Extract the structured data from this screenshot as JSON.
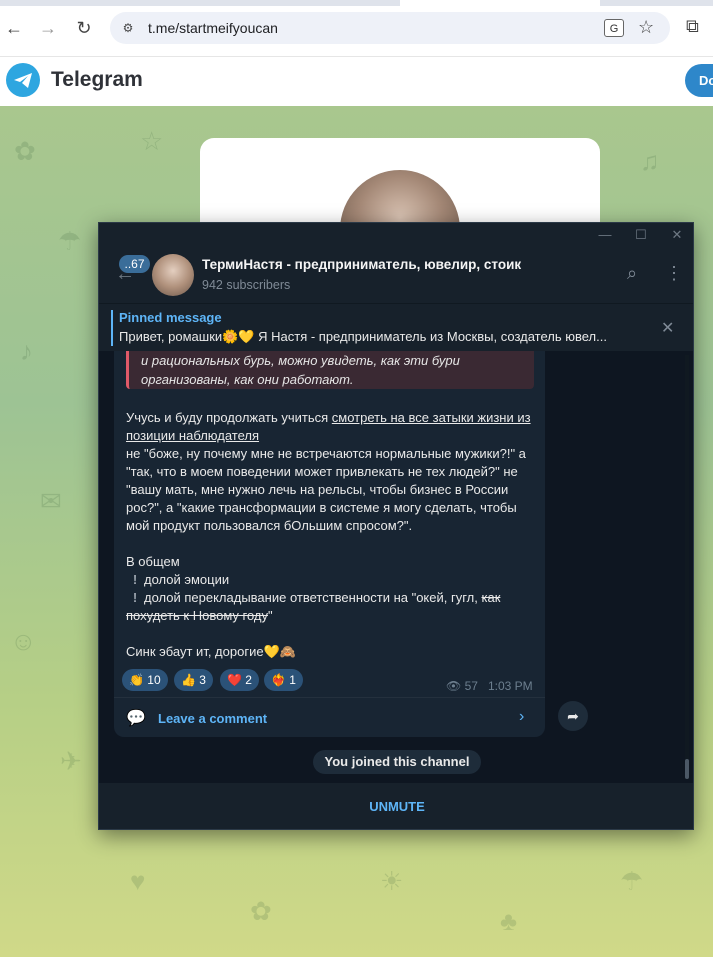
{
  "browser": {
    "url": "t.me/startmeifyoucan",
    "icons": [
      "back-arrow-icon",
      "forward-arrow-icon",
      "reload-icon",
      "site-info-icon",
      "translate-icon",
      "star-icon",
      "extensions-icon"
    ]
  },
  "site_header": {
    "title": "Telegram",
    "download_label": "Do"
  },
  "window": {
    "controls": [
      "minimize",
      "maximize",
      "close"
    ]
  },
  "chat": {
    "unread_count": "..67",
    "title": "ТермиНастя - предприниматель, ювелир, стоик",
    "subtitle": "942 subscribers"
  },
  "pinned": {
    "title": "Pinned message",
    "text": "Привет, ромашки🌼💛 Я Настя - предприниматель из Москвы, создатель ювел..."
  },
  "message": {
    "quote": "и рациональных бурь, можно увидеть, как эти бури организованы, как они работают.",
    "p1_link": "смотреть на все затыки жизни из позиции наблюдателя",
    "p1_lead": "Учусь и буду продолжать учиться ",
    "p1_rest": "не \"боже, ну почему мне не встречаются нормальные мужики?!\" а \"так, что в моем поведении может привлекать не тех людей?\" не \"вашу мать, мне нужно лечь на рельсы, чтобы бизнес в России рос?\", а \"какие трансформации в системе я могу сделать, чтобы мой продукт пользовался бОльшим спросом?\".",
    "p2_title": "В общем",
    "bullet1": "долой эмоции",
    "bullet2_lead": "долой перекладывание ответственности на \"окей, гугл, ",
    "bullet2_struck": "как похудеть к Новому году",
    "bullet2_tail": "\"",
    "closing": "Синк эбаут ит, дорогие💛🙈",
    "reactions": [
      {
        "emoji": "👏",
        "count": "10"
      },
      {
        "emoji": "👍",
        "count": "3"
      },
      {
        "emoji": "❤️",
        "count": "2"
      },
      {
        "emoji": "❤️‍🔥",
        "count": "1"
      }
    ],
    "views": "57",
    "time": "1:03 PM",
    "comment_label": "Leave a comment"
  },
  "service": {
    "joined_text": "You joined this channel"
  },
  "bottom": {
    "unmute_label": "UNMUTE"
  },
  "colors": {
    "accent": "#5eb5f7",
    "window_bg": "#17212b",
    "chat_bg": "#0e1621",
    "bubble_bg": "#182533",
    "reaction_bg": "#2b5278",
    "telegram_blue": "#2ea6e0"
  }
}
